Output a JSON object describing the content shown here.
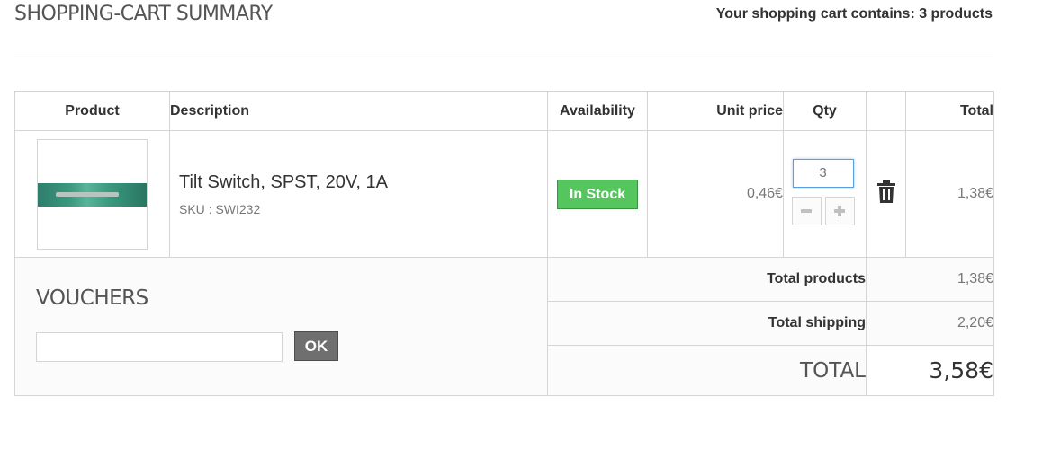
{
  "header": {
    "title": "SHOPPING-CART SUMMARY",
    "cart_count_text": "Your shopping cart contains: 3 products"
  },
  "columns": {
    "product": "Product",
    "description": "Description",
    "availability": "Availability",
    "unit_price": "Unit price",
    "qty": "Qty",
    "total": "Total"
  },
  "item": {
    "name": "Tilt Switch, SPST, 20V, 1A",
    "sku": "SKU : SWI232",
    "availability": "In Stock",
    "unit_price": "0,46€",
    "qty": "3",
    "total": "1,38€",
    "minus_icon": "minus-icon",
    "plus_icon": "plus-icon",
    "delete_icon": "trash-icon"
  },
  "vouchers": {
    "title": "VOUCHERS",
    "input_value": "",
    "ok_label": "OK"
  },
  "summary": {
    "total_products_label": "Total products",
    "total_products_value": "1,38€",
    "total_shipping_label": "Total shipping",
    "total_shipping_value": "2,20€",
    "grand_total_label": "TOTAL",
    "grand_total_value": "3,58€"
  },
  "colors": {
    "in_stock": "#55c65e",
    "ok_button": "#6f6f6f",
    "qty_focus": "#5c9ee6"
  }
}
